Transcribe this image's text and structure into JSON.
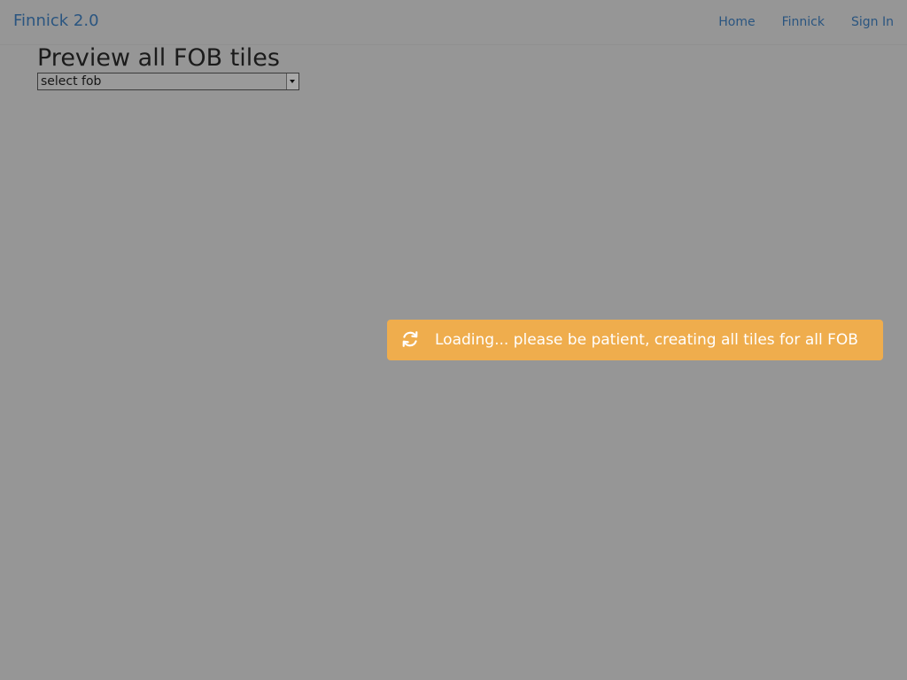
{
  "header": {
    "brand": "Finnick 2.0",
    "nav": [
      {
        "label": "Home"
      },
      {
        "label": "Finnick"
      },
      {
        "label": "Sign In"
      }
    ]
  },
  "main": {
    "title": "Preview all FOB tiles",
    "select": {
      "value": "select fob"
    }
  },
  "notification": {
    "icon": "refresh-icon",
    "message": "Loading... please be patient, creating all tiles for all FOB",
    "color": "#efad4d"
  }
}
